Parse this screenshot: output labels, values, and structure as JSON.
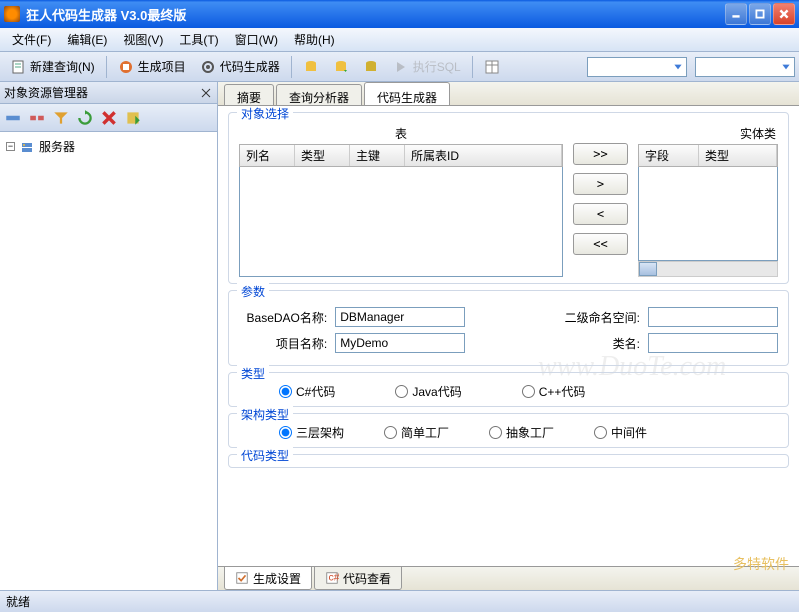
{
  "title": "狂人代码生成器  V3.0最终版",
  "menus": {
    "file": "文件(F)",
    "edit": "编辑(E)",
    "view": "视图(V)",
    "tool": "工具(T)",
    "window": "窗口(W)",
    "help": "帮助(H)"
  },
  "toolbar": {
    "new_query": "新建查询(N)",
    "gen_project": "生成项目",
    "code_gen": "代码生成器",
    "exec_sql": "执行SQL"
  },
  "left_panel": {
    "title": "对象资源管理器",
    "tree_root": "服务器"
  },
  "main_tabs": {
    "summary": "摘要",
    "query_analyzer": "查询分析器",
    "code_generator": "代码生成器"
  },
  "sections": {
    "obj_select": "对象选择",
    "table_label": "表",
    "entity_label": "实体类",
    "cols": {
      "col_name": "列名",
      "type": "类型",
      "pk": "主键",
      "table_id": "所属表ID",
      "field": "字段",
      "type2": "类型"
    },
    "params": "参数",
    "param_labels": {
      "basedao": "BaseDAO名称:",
      "ns2": "二级命名空间:",
      "project": "项目名称:",
      "classname": "类名:"
    },
    "param_values": {
      "basedao": "DBManager",
      "ns2": "",
      "project": "MyDemo",
      "classname": ""
    },
    "type_group": "类型",
    "types": {
      "csharp": "C#代码",
      "java": "Java代码",
      "cpp": "C++代码"
    },
    "arch_group": "架构类型",
    "arches": {
      "three": "三层架构",
      "simple": "简单工厂",
      "abstract": "抽象工厂",
      "middleware": "中间件"
    },
    "code_type_group": "代码类型"
  },
  "transfer": {
    "all_r": ">>",
    "one_r": ">",
    "one_l": "<",
    "all_l": "<<"
  },
  "bottom_tabs": {
    "gen_settings": "生成设置",
    "code_view": "代码查看"
  },
  "status": "就绪",
  "watermark": "www.DuoTe.com",
  "watermark2": "多特软件"
}
